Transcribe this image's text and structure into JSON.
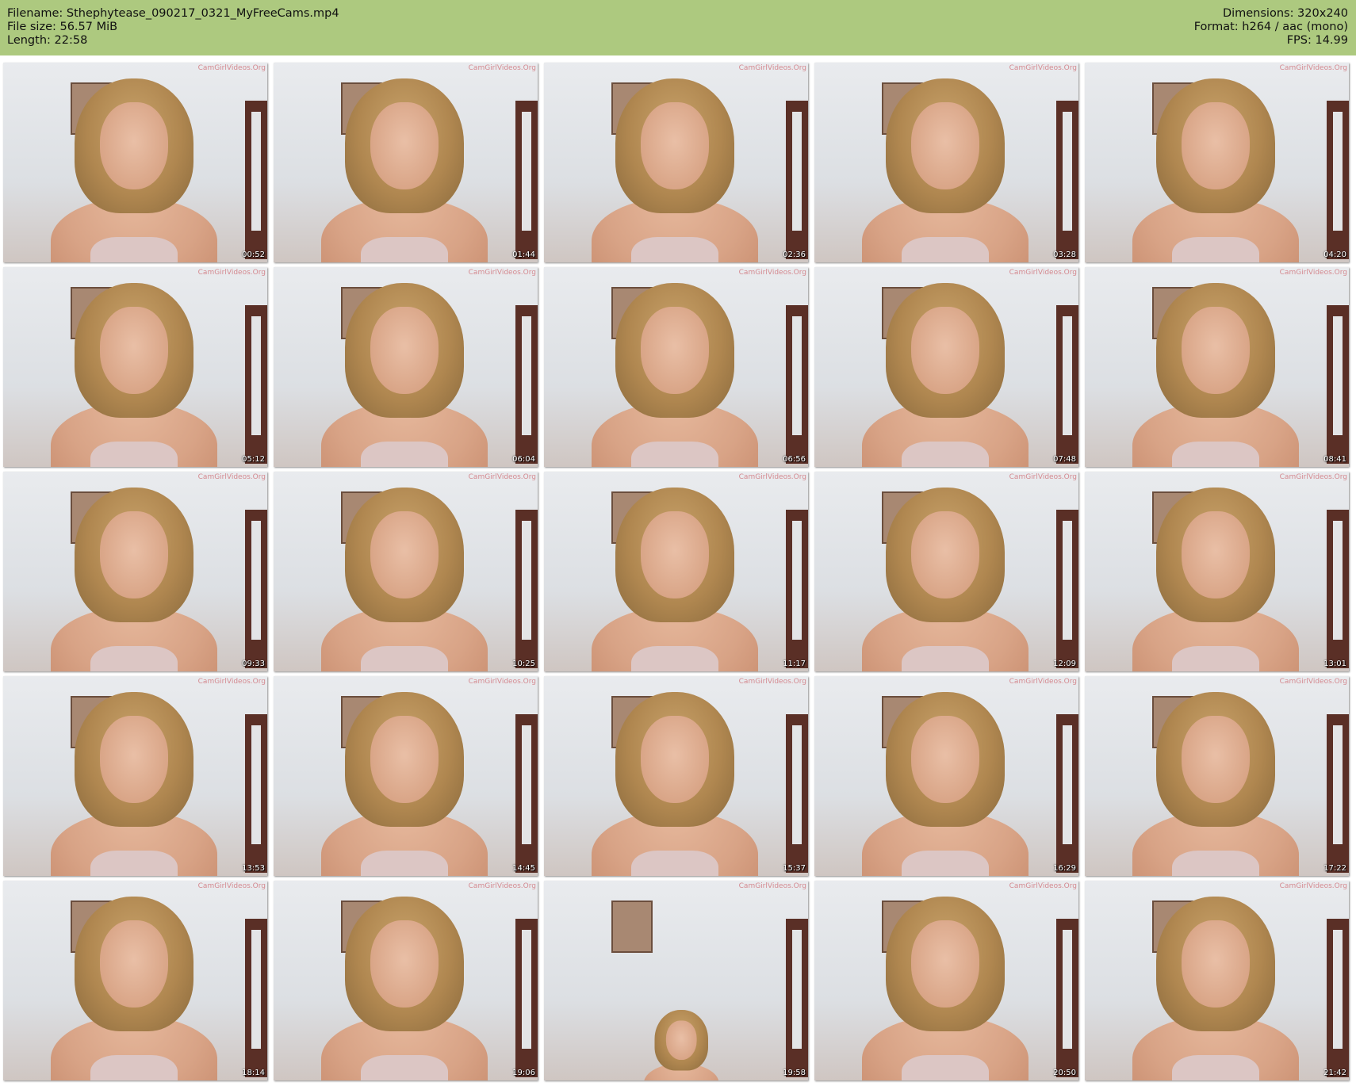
{
  "header": {
    "filename_label": "Filename: Sthephytease_090217_0321_MyFreeCams.mp4",
    "filesize_label": "File size: 56.57 MiB",
    "length_label": "Length: 22:58",
    "dimensions_label": "Dimensions: 320x240",
    "format_label": "Format: h264 / aac (mono)",
    "fps_label": "FPS: 14.99",
    "background_color": "#adc97f"
  },
  "thumbnails": {
    "watermark": "CamGirlVideos.Org",
    "timestamps": [
      "00:52",
      "01:44",
      "02:36",
      "03:28",
      "04:20",
      "05:12",
      "06:04",
      "06:56",
      "07:48",
      "08:41",
      "09:33",
      "10:25",
      "11:17",
      "12:09",
      "13:01",
      "13:53",
      "14:45",
      "15:37",
      "16:29",
      "17:22",
      "18:14",
      "19:06",
      "19:58",
      "20:50",
      "21:42"
    ]
  }
}
